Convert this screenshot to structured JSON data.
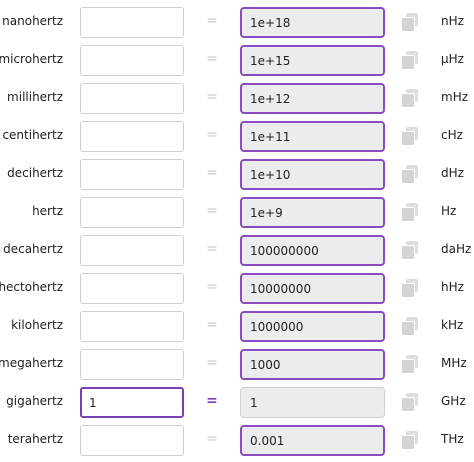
{
  "rows": [
    {
      "unit": "nanohertz",
      "input": "",
      "result": "1e+18",
      "symbol": "nHz"
    },
    {
      "unit": "microhertz",
      "input": "",
      "result": "1e+15",
      "symbol": "μHz"
    },
    {
      "unit": "millihertz",
      "input": "",
      "result": "1e+12",
      "symbol": "mHz"
    },
    {
      "unit": "centihertz",
      "input": "",
      "result": "1e+11",
      "symbol": "cHz"
    },
    {
      "unit": "decihertz",
      "input": "",
      "result": "1e+10",
      "symbol": "dHz"
    },
    {
      "unit": "hertz",
      "input": "",
      "result": "1e+9",
      "symbol": "Hz"
    },
    {
      "unit": "decahertz",
      "input": "",
      "result": "100000000",
      "symbol": "daHz"
    },
    {
      "unit": "hectohertz",
      "input": "",
      "result": "10000000",
      "symbol": "hHz"
    },
    {
      "unit": "kilohertz",
      "input": "",
      "result": "1000000",
      "symbol": "kHz"
    },
    {
      "unit": "megahertz",
      "input": "",
      "result": "1000",
      "symbol": "MHz"
    },
    {
      "unit": "gigahertz",
      "input": "1",
      "result": "1",
      "symbol": "GHz"
    },
    {
      "unit": "terahertz",
      "input": "",
      "result": "0.001",
      "symbol": "THz"
    }
  ],
  "equals_sign": "=",
  "active_row_unit": "gigahertz",
  "colors": {
    "accent": "#7b3fb3",
    "result_border": "#8a4cc0",
    "result_background": "#ececee",
    "muted": "#c8c8c8"
  },
  "icons": {
    "copy": "copy-icon"
  }
}
